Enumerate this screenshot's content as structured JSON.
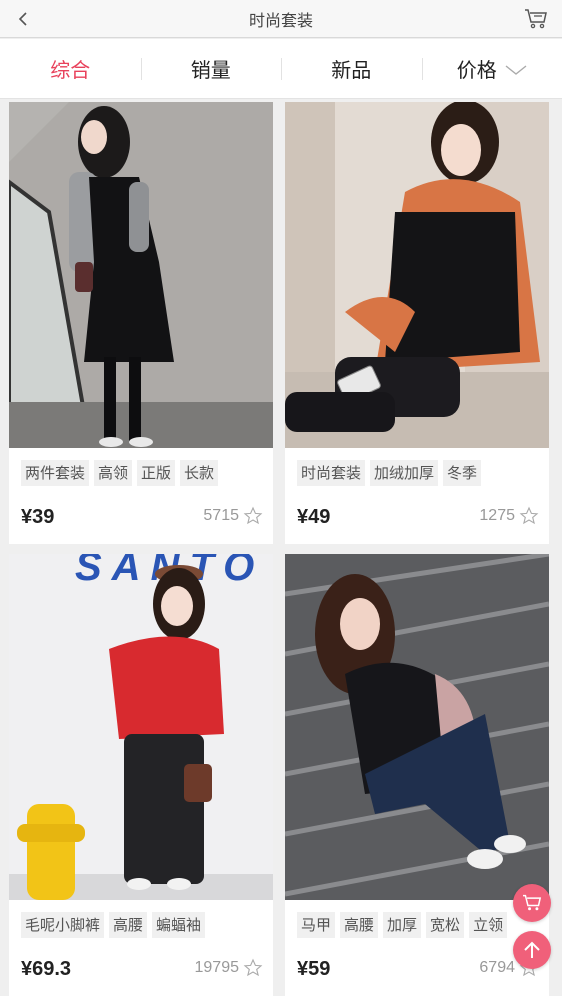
{
  "header": {
    "title": "时尚套装",
    "back_icon": "chevron-left-icon",
    "cart_icon": "shopping-cart-icon"
  },
  "tabs": [
    {
      "label": "综合",
      "active": true
    },
    {
      "label": "销量",
      "active": false
    },
    {
      "label": "新品",
      "active": false
    },
    {
      "label": "价格",
      "active": false,
      "icon": "chevron-down-icon"
    }
  ],
  "accent_color": "#e8425c",
  "products": [
    {
      "tags": [
        "两件套装",
        "高领",
        "正版",
        "长款"
      ],
      "price": "¥39",
      "count": "5715",
      "icon": "star-icon"
    },
    {
      "tags": [
        "时尚套装",
        "加绒加厚",
        "冬季"
      ],
      "price": "¥49",
      "count": "1275",
      "icon": "star-icon"
    },
    {
      "tags": [
        "毛呢小脚裤",
        "高腰",
        "蝙蝠袖"
      ],
      "price": "¥69.3",
      "count": "19795",
      "icon": "star-icon"
    },
    {
      "tags": [
        "马甲",
        "高腰",
        "加厚",
        "宽松",
        "立领"
      ],
      "price": "¥59",
      "count": "6794",
      "icon": "star-icon"
    }
  ],
  "photo_text": {
    "sign": "SANTO"
  },
  "floating": {
    "cart_icon": "shopping-cart-icon",
    "top_icon": "arrow-up-icon"
  }
}
